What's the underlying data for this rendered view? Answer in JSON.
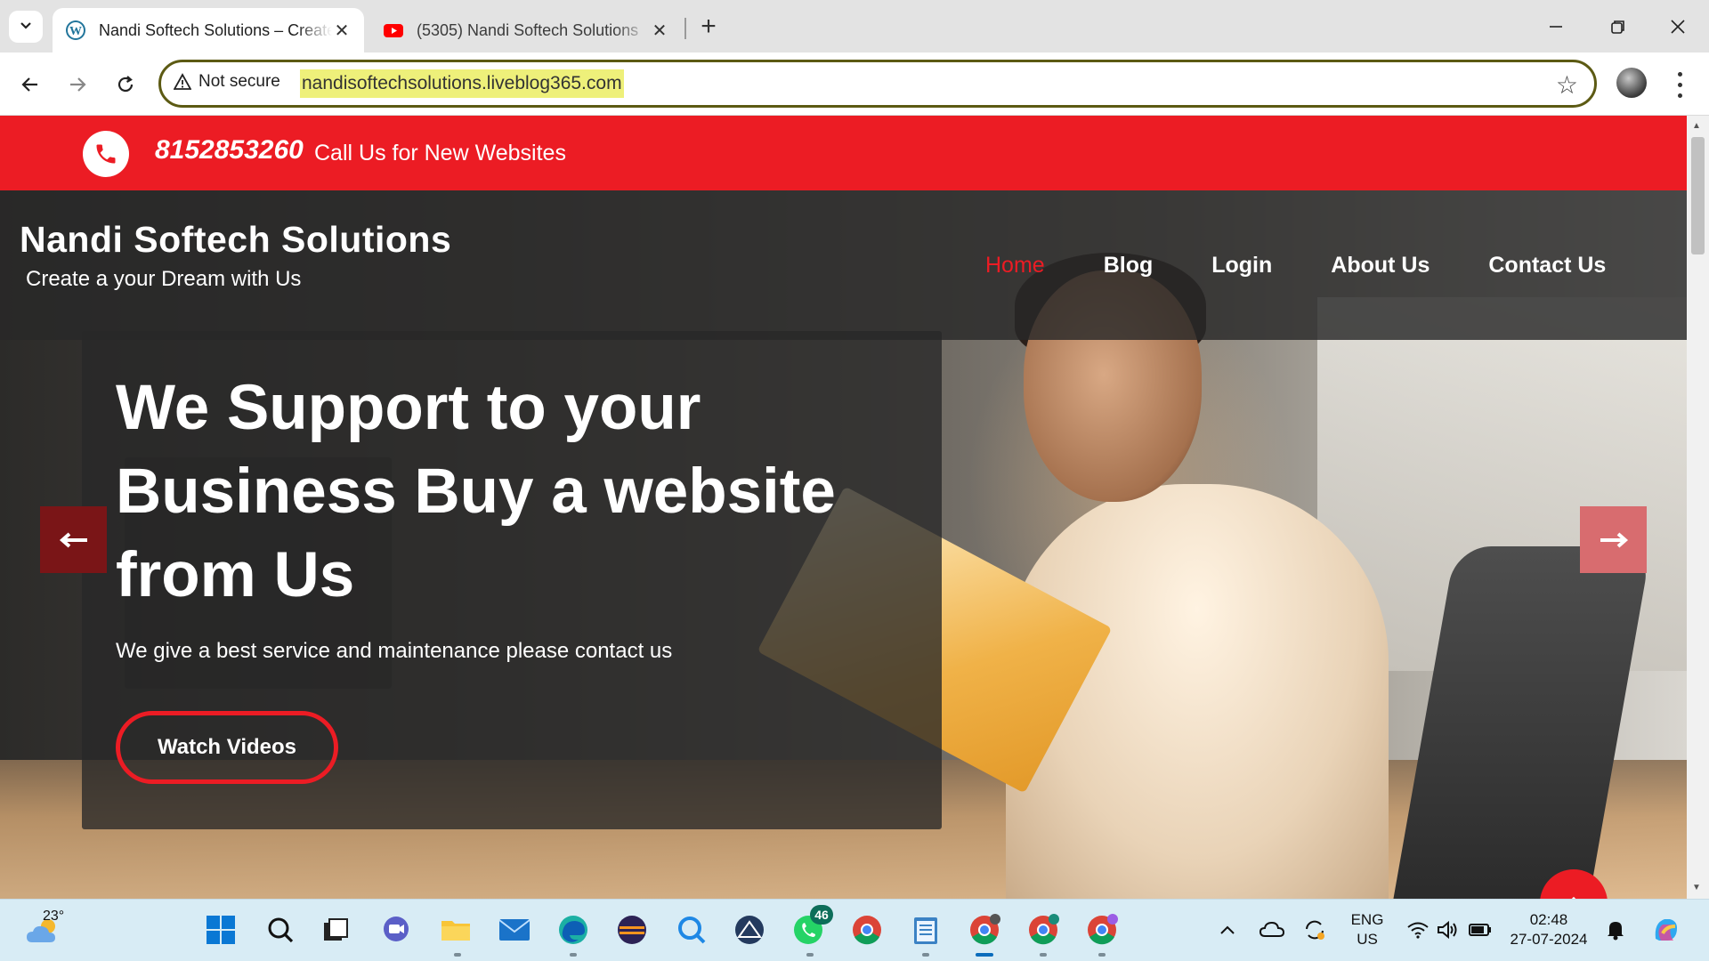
{
  "browser": {
    "tabs": [
      {
        "title": "Nandi Softech Solutions – Create a your Dream with Us",
        "active": true,
        "favicon": "wordpress-icon"
      },
      {
        "title": "(5305) Nandi Softech Solutions",
        "active": false,
        "favicon": "youtube-icon"
      }
    ],
    "address": {
      "security_label": "Not secure",
      "url": "nandisoftechsolutions.liveblog365.com"
    }
  },
  "site": {
    "phone": "8152853260",
    "call_text": "Call Us for New Websites",
    "title": "Nandi Softech Solutions",
    "tagline": "Create a your Dream with Us",
    "nav": [
      {
        "label": "Home",
        "current": true
      },
      {
        "label": "Blog",
        "current": false
      },
      {
        "label": "Login",
        "current": false
      },
      {
        "label": "About Us",
        "current": false
      },
      {
        "label": "Contact Us",
        "current": false
      }
    ],
    "slide": {
      "heading": "We Support to your Business Buy a website from Us",
      "subtext": "We give a best service and maintenance please contact us",
      "button": "Watch Videos"
    }
  },
  "taskbar": {
    "weather_temp": "23°",
    "whatsapp_badge": "46",
    "language": "ENG",
    "region": "US",
    "time": "02:48",
    "date": "27-07-2024"
  },
  "colors": {
    "brand_red": "#ec1c24",
    "header_overlay": "#282828",
    "url_highlight": "#eef07a"
  }
}
